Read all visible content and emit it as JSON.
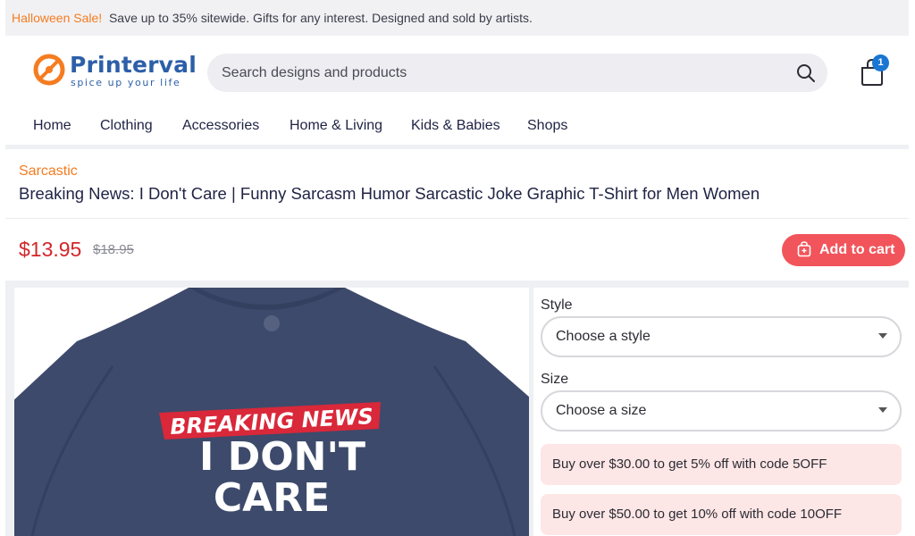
{
  "promo_bar": {
    "highlight": "Halloween Sale!",
    "text": "Save up to 35% sitewide. Gifts for any interest. Designed and sold by artists.",
    "highlight_color": "#f57c20"
  },
  "header": {
    "logo": {
      "brand": "Printerval",
      "tagline": "spice up your life",
      "brand_color": "#2d5fa8",
      "mark_color": "#f57c20"
    },
    "search": {
      "placeholder": "Search designs and products",
      "icon": "search-icon"
    },
    "cart": {
      "icon": "shopping-bag-icon",
      "count": "1",
      "badge_color": "#1976d2"
    }
  },
  "nav": {
    "items": [
      {
        "label": "Home"
      },
      {
        "label": "Clothing"
      },
      {
        "label": "Accessories"
      },
      {
        "label": "Home & Living"
      },
      {
        "label": "Kids & Babies"
      },
      {
        "label": "Shops"
      }
    ]
  },
  "product": {
    "category": "Sarcastic",
    "title": "Breaking News: I Don't Care | Funny Sarcasm Humor Sarcastic Joke Graphic T-Shirt for Men Women",
    "price": "$13.95",
    "old_price": "$18.95",
    "add_to_cart": "Add to cart",
    "add_to_cart_icon": "bag-plus-icon",
    "accent_color": "#f2545b",
    "price_color": "#d2262b",
    "image": {
      "banner_text": "BREAKING NEWS",
      "line1": "I DON'T",
      "line2": "CARE",
      "shirt_color": "#3d4a6b"
    }
  },
  "options": {
    "style": {
      "label": "Style",
      "value": "Choose a style"
    },
    "size": {
      "label": "Size",
      "value": "Choose a size"
    }
  },
  "offers": [
    {
      "text": "Buy over $30.00 to get 5% off with code 5OFF"
    },
    {
      "text": "Buy over $50.00 to get 10% off with code 10OFF"
    }
  ]
}
